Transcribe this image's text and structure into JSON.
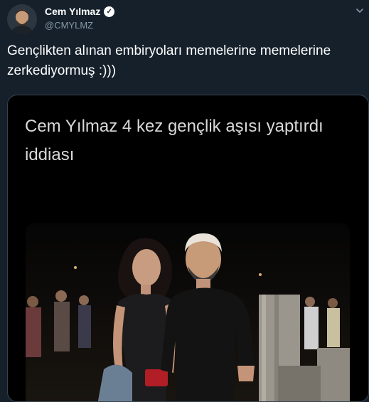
{
  "tweet": {
    "author_name": "Cem Yılmaz",
    "author_handle": "@CMYLMZ",
    "verified_glyph": "✓",
    "text": "Gençlikten alınan embiryoları memelerine memelerine zerkediyormuş :)))"
  },
  "card": {
    "headline": "Cem Yılmaz 4 kez gençlik aşısı yaptırdı iddiası"
  },
  "icons": {
    "verified": "verified-badge-icon",
    "menu": "chevron-down-icon"
  },
  "colors": {
    "background": "#15202b",
    "secondary_text": "#8899a6",
    "card_background": "#000000",
    "border": "#38444d"
  }
}
